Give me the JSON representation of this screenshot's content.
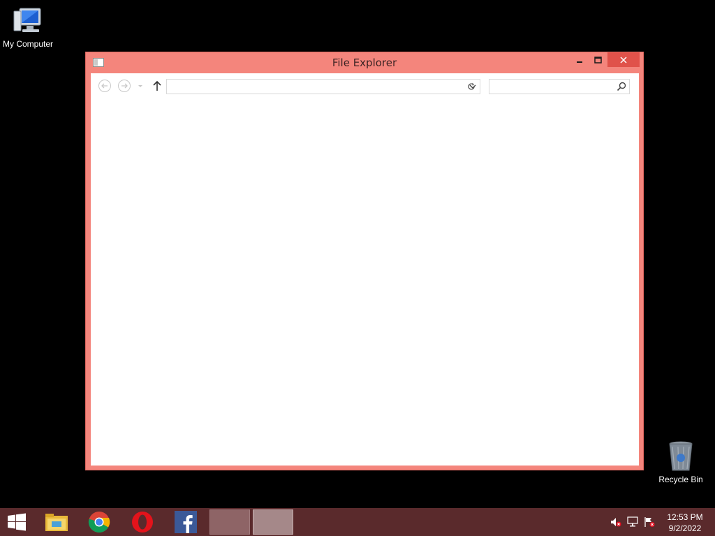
{
  "desktop": {
    "icons": [
      {
        "label": "My Computer",
        "icon": "computer-icon"
      },
      {
        "label": "Recycle Bin",
        "icon": "recycle-bin-icon"
      }
    ]
  },
  "window": {
    "title": "File Explorer",
    "accent": "#f4857c",
    "address_value": "",
    "search_placeholder": ""
  },
  "taskbar": {
    "background": "#5a2a2c",
    "apps": [
      {
        "name": "File Explorer",
        "icon": "file-explorer-icon"
      },
      {
        "name": "Chrome",
        "icon": "chrome-icon"
      },
      {
        "name": "Opera",
        "icon": "opera-icon"
      },
      {
        "name": "Facebook",
        "icon": "facebook-icon"
      }
    ],
    "clock": {
      "time": "12:53 PM",
      "date": "9/2/2022"
    }
  }
}
